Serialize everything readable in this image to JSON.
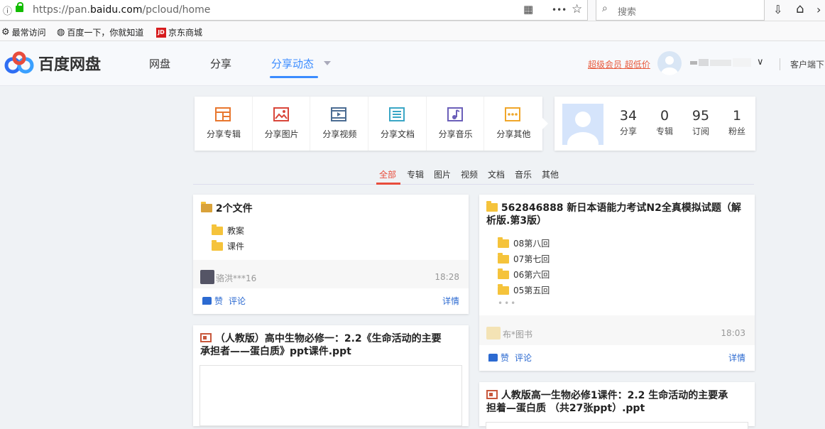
{
  "browser": {
    "url_prefix": "https://pan.",
    "url_domain": "baidu.com",
    "url_path": "/pcloud/home",
    "search_placeholder": "搜索",
    "menu_dots": "•••",
    "star": "☆",
    "home": "⌂"
  },
  "bookmarks": [
    {
      "label": "最常访问",
      "icon": "gear-icon"
    },
    {
      "label": "百度一下，你就知道",
      "icon": "globe-icon"
    },
    {
      "label": "京东商城",
      "icon": "jd-icon"
    }
  ],
  "header": {
    "logo_text": "百度网盘",
    "nav": [
      "网盘",
      "分享",
      "分享动态"
    ],
    "vip_label": "超级会员 超低价",
    "client_label": "客户端下"
  },
  "share_tiles": [
    {
      "label": "分享专辑",
      "icon": "album-icon",
      "color": "#e8772e"
    },
    {
      "label": "分享图片",
      "icon": "image-icon",
      "color": "#d9463a"
    },
    {
      "label": "分享视频",
      "icon": "video-icon",
      "color": "#4c6d93"
    },
    {
      "label": "分享文档",
      "icon": "document-icon",
      "color": "#3aa6c5"
    },
    {
      "label": "分享音乐",
      "icon": "music-icon",
      "color": "#6b5fb9"
    },
    {
      "label": "分享其他",
      "icon": "other-icon",
      "color": "#f0a62a"
    }
  ],
  "profile": {
    "stats": [
      {
        "value": "34",
        "label": "分享"
      },
      {
        "value": "0",
        "label": "专辑"
      },
      {
        "value": "95",
        "label": "订阅"
      },
      {
        "value": "1",
        "label": "粉丝"
      }
    ]
  },
  "filter_tabs": [
    "全部",
    "专辑",
    "图片",
    "视频",
    "文档",
    "音乐",
    "其他"
  ],
  "feed": {
    "card1": {
      "title": "2个文件",
      "files": [
        "教案",
        "课件"
      ],
      "user": "骆洪***16",
      "time": "18:28",
      "like": "赞",
      "comment": "评论",
      "detail": "详情"
    },
    "card2": {
      "title_line1": "562846888  新日本语能力考试N2全真模拟试题（解",
      "title_line2": "析版.第3版）",
      "files": [
        "08第八回",
        "07第七回",
        "06第六回",
        "05第五回"
      ],
      "more": "•••",
      "user": "布*图书",
      "time": "18:03",
      "like": "赞",
      "comment": "评论",
      "detail": "详情"
    },
    "card3": {
      "title_line1": "（人教版）高中生物必修一：2.2《生命活动的主要",
      "title_line2": "承担者——蛋白质》ppt课件.ppt"
    },
    "card4": {
      "title_line1": "人教版高一生物必修1课件：2.2 生命活动的主要承",
      "title_line2": "担着—蛋白质 （共27张ppt）.ppt"
    }
  }
}
